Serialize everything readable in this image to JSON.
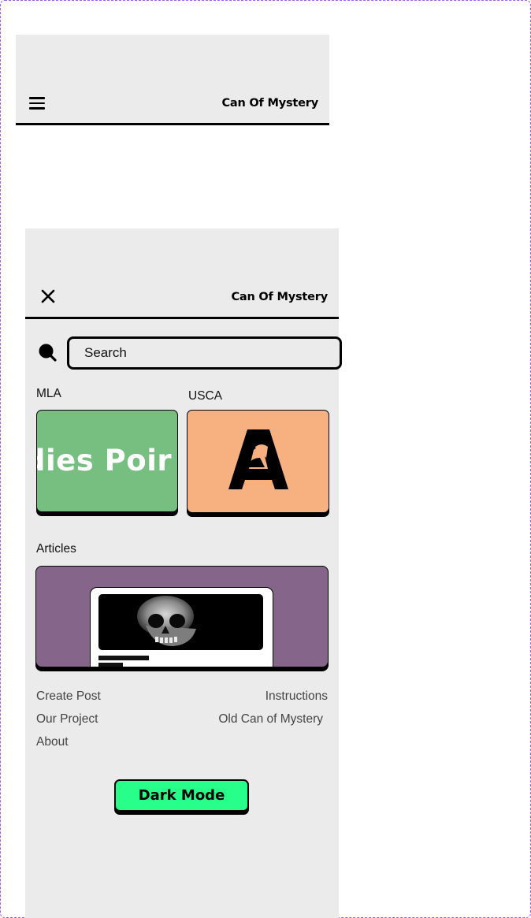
{
  "brand": {
    "name": "Can Of Mystery"
  },
  "icons": {
    "menu": "hamburger-menu-icon",
    "close": "close-x-icon",
    "search": "magnifier-icon",
    "usca_logo": "letter-a-with-horse-icon"
  },
  "search": {
    "placeholder": "Search"
  },
  "categories": {
    "mla": {
      "label": "MLA",
      "banner_text": "dies  Poir"
    },
    "usca": {
      "label": "USCA"
    },
    "articles": {
      "label": "Articles"
    }
  },
  "links": {
    "create_post": "Create Post",
    "instructions": "Instructions",
    "our_project": "Our Project",
    "old_can": "Old Can of Mystery",
    "about": "About"
  },
  "dark_mode": {
    "label": "Dark Mode"
  },
  "colors": {
    "panel_bg": "#ebebeb",
    "mla_card": "#76bf80",
    "usca_card": "#f7b080",
    "articles_card": "#856589",
    "dark_mode_button": "#27ff8a",
    "frame_dash": "#9b5cf0"
  }
}
